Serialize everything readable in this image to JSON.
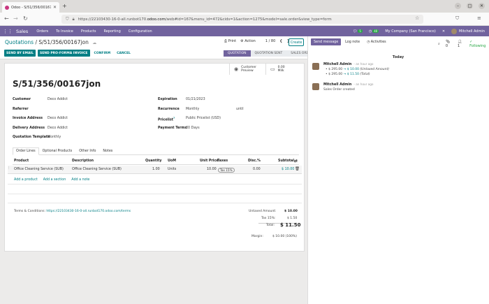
{
  "browser": {
    "tab_title": "Odoo - S/51/356/00167jo",
    "url_prefix": "https://22103430-16-0-all.runbot170.",
    "url_domain": "odoo.com",
    "url_suffix": "/web#id=167&menu_id=472&cids=1&action=1275&model=sale.order&view_type=form"
  },
  "navbar": {
    "app_name": "Sales",
    "menus": [
      "Orders",
      "To Invoice",
      "Products",
      "Reporting",
      "Configuration"
    ],
    "chat_count": "5",
    "activity_count": "40",
    "company": "My Company (San Francisco)",
    "user": "Mitchell Admin"
  },
  "control_panel": {
    "breadcrumb_parent": "Quotations",
    "breadcrumb_separator": " / ",
    "breadcrumb_current": "S/51/356/00167jon",
    "print_label": "Print",
    "action_label": "Action",
    "pager": "1 / 80",
    "create_label": "Create",
    "buttons": [
      "SEND BY EMAIL",
      "SEND PRO-FORMA INVOICE"
    ],
    "link_buttons": [
      "CONFIRM",
      "CANCEL"
    ],
    "statuses": [
      "QUOTATION",
      "QUOTATION SENT",
      "SALES ORDER"
    ],
    "active_status": "QUOTATION"
  },
  "stat_buttons": [
    {
      "icon": "user-icon",
      "label": "Customer Preview"
    },
    {
      "icon": "money-icon",
      "value": "0.00",
      "label": "Milk"
    }
  ],
  "record": {
    "name": "S/51/356/00167jon",
    "left_fields": [
      {
        "label": "Customer",
        "value": "Deco Addict"
      },
      {
        "label": "Referrer",
        "value": ""
      },
      {
        "label": "Invoice Address",
        "value": "Deco Addict"
      },
      {
        "label": "Delivery Address",
        "value": "Deco Addict"
      },
      {
        "label": "Quotation Template",
        "value": "Monthly"
      }
    ],
    "right_fields": [
      {
        "label": "Expiration",
        "value": "01/21/2023"
      },
      {
        "label": "Recurrence",
        "value": "Monthly"
      },
      {
        "label": "Pricelist",
        "value": "Public Pricelist (USD)"
      },
      {
        "label": "Payment Terms",
        "value": "30 Days"
      }
    ],
    "recurrence_until": "until",
    "pricelist_help": "?"
  },
  "tabs": [
    "Order Lines",
    "Optional Products",
    "Other Info",
    "Notes"
  ],
  "lines": {
    "headers": [
      "Product",
      "Description",
      "Quantity",
      "UoM",
      "Unit Price",
      "Taxes",
      "Disc.%",
      "Subtotal"
    ],
    "rows": [
      {
        "product": "Office Cleaning Service (SUB)",
        "description": "Office Cleaning Service (SUB)",
        "quantity": "1.00",
        "uom": "Units",
        "unit_price": "10.00",
        "taxes": "Tax 15%",
        "discount": "0.00",
        "subtotal": "$ 10.00"
      }
    ],
    "add_links": [
      "Add a product",
      "Add a section",
      "Add a note"
    ]
  },
  "terms": {
    "label": "Terms & Conditions: ",
    "link": "https://22103430-16-0-all.runbot170.odoo.com/terms"
  },
  "totals": {
    "untaxed_label": "Untaxed Amount:",
    "untaxed": "$ 10.00",
    "tax_label": "Tax 15%:",
    "tax": "$ 1.50",
    "total_label": "Total:",
    "total": "$ 11.50",
    "margin_label": "Margin:",
    "margin": "$ 10.00 (100%)"
  },
  "chatter": {
    "send_message": "Send message",
    "log_note": "Log note",
    "activities": "Activities",
    "attachments": "0",
    "followers": "1",
    "following": "Following",
    "today": "Today",
    "messages": [
      {
        "author": "Mitchell Admin",
        "date": "- an hour ago",
        "lines": [
          {
            "old": "$ 295.00",
            "new": "$ 10.00",
            "field": "(Untaxed Amount)"
          },
          {
            "old": "$ 295.00",
            "new": "$ 11.50",
            "field": "(Total)"
          }
        ]
      },
      {
        "author": "Mitchell Admin",
        "date": "- an hour ago",
        "text": "Sales Order created"
      }
    ]
  },
  "colors": {
    "brand": "#71639e",
    "accent": "#017e84"
  }
}
